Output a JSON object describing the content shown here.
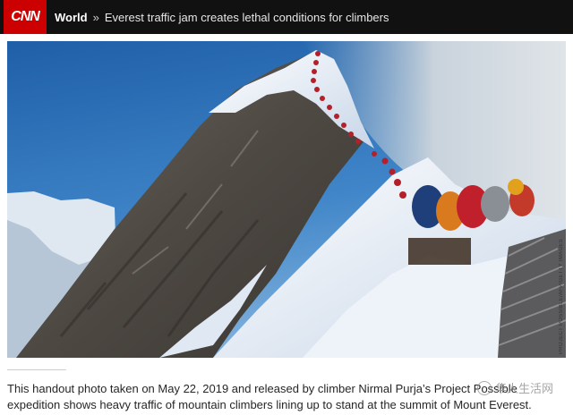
{
  "header": {
    "logo_text": "CNN",
    "section": "World",
    "separator": "»",
    "headline": "Everest traffic jam creates lethal conditions for climbers"
  },
  "photo": {
    "credit": "PROJECT POSSIBLE/AFP/GETTY IMAGES"
  },
  "caption": {
    "text": "This handout photo taken on May 22, 2019 and released by climber Nirmal Purja’s Project Possible expedition shows heavy traffic of mountain climbers lining up to stand at the summit of Mount Everest."
  },
  "watermark": {
    "text": "华人生活网"
  },
  "colors": {
    "brand_red": "#cc0000",
    "topbar": "#111111"
  }
}
